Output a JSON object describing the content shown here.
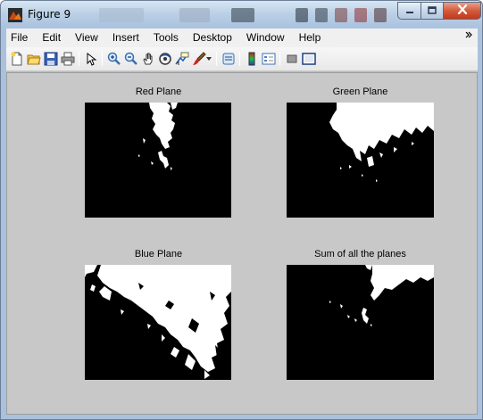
{
  "window": {
    "title": "Figure 9",
    "app_icon": "matlab-figure-icon"
  },
  "window_controls": {
    "minimize": "minimize-icon",
    "maximize": "maximize-icon",
    "close": "close-icon"
  },
  "menu": {
    "items": [
      "File",
      "Edit",
      "View",
      "Insert",
      "Tools",
      "Desktop",
      "Window",
      "Help"
    ],
    "overflow_icon": "chevron-icon"
  },
  "toolbar": {
    "buttons": [
      "new-figure-icon",
      "open-file-icon",
      "save-icon",
      "print-icon",
      "pointer-icon",
      "zoom-in-icon",
      "zoom-out-icon",
      "pan-hand-icon",
      "rotate-3d-icon",
      "data-cursor-icon",
      "brush-icon",
      "brush-dropdown-icon",
      "link-plot-icon",
      "colorbar-icon",
      "legend-icon",
      "hide-plot-tools-icon",
      "show-plot-tools-icon"
    ]
  },
  "plots": [
    {
      "title": "Red Plane"
    },
    {
      "title": "Green Plane"
    },
    {
      "title": "Blue Plane"
    },
    {
      "title": "Sum of all the planes"
    }
  ],
  "colors": {
    "figure_background": "#c8c8c8",
    "plot_background": "#000000",
    "plot_foreground": "#ffffff",
    "close_button": "#c9452a"
  }
}
